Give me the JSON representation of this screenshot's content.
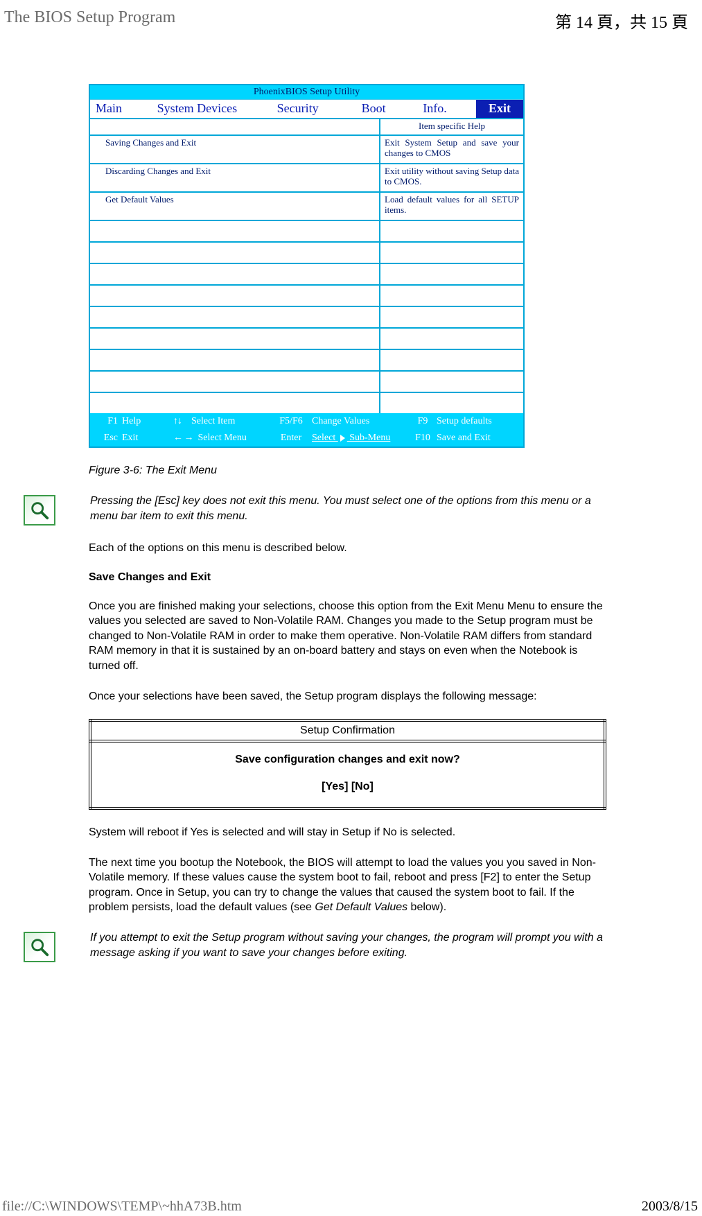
{
  "header": {
    "title": "The BIOS Setup Program",
    "page_indicator": "第 14 頁，共 15 頁"
  },
  "bios": {
    "utility_title": "PhoenixBIOS Setup Utility",
    "menubar": {
      "main": "Main",
      "system_devices": "System Devices",
      "security": "Security",
      "boot": "Boot",
      "info": "Info.",
      "exit": "Exit"
    },
    "help_header": "Item specific Help",
    "rows": [
      {
        "item": "Saving Changes and Exit",
        "help": "Exit System Setup and save your changes to CMOS"
      },
      {
        "item": "Discarding Changes and Exit",
        "help": "Exit utility without saving Setup data to CMOS."
      },
      {
        "item": "Get Default Values",
        "help": "Load default values for all SETUP items."
      }
    ],
    "footer": {
      "f1": "F1",
      "help": "Help",
      "updown": "↑↓",
      "select_item": "Select Item",
      "f5f6": "F5/F6",
      "change_values": "Change Values",
      "f9": "F9",
      "setup_defaults": "Setup defaults",
      "esc": "Esc",
      "exit": "Exit",
      "leftright": "← →",
      "select_menu": "Select Menu",
      "enter": "Enter",
      "select_submenu": "Select     Sub-Menu",
      "f10": "F10",
      "save_exit": "Save and Exit"
    }
  },
  "body": {
    "figure_caption": "Figure 3-6: The Exit Menu",
    "note1": "Pressing the [Esc] key does not exit this menu. You must select one of the options from this menu or a menu bar item to exit this menu.",
    "intro": "Each of the options on this menu is described below.",
    "h_save": "Save Changes and Exit",
    "p_save1": "Once you are finished making your selections, choose this option from the Exit Menu Menu to ensure the values you selected are saved to Non-Volatile RAM. Changes you made to the Setup program must be changed to Non-Volatile RAM in order to make them operative. Non-Volatile RAM differs from standard RAM memory in that it is sustained by an on-board battery and stays on even when the Notebook is turned off.",
    "p_save2": "Once your selections have been saved, the Setup program displays the following message:",
    "dialog": {
      "title": "Setup Confirmation",
      "line1": "Save configuration changes and exit now?",
      "line2": "[Yes] [No]"
    },
    "p_after1": "System will reboot if Yes is selected and will stay in Setup if No is selected.",
    "p_after2_a": "The next time you bootup the Notebook, the BIOS will attempt to load the values you you saved in Non-Volatile memory. If these values cause the system boot to fail, reboot and press [F2] to enter the Setup program. Once in Setup, you can try to change the values that caused the system boot to fail. If the problem persists, load the default values (see ",
    "p_after2_em": "Get Default Values",
    "p_after2_b": " below).",
    "note2": "If you attempt to exit the Setup program without saving your changes, the program will prompt you with a message asking if you want to save your changes before exiting."
  },
  "footer": {
    "path": "file://C:\\WINDOWS\\TEMP\\~hhA73B.htm",
    "date": "2003/8/15"
  }
}
